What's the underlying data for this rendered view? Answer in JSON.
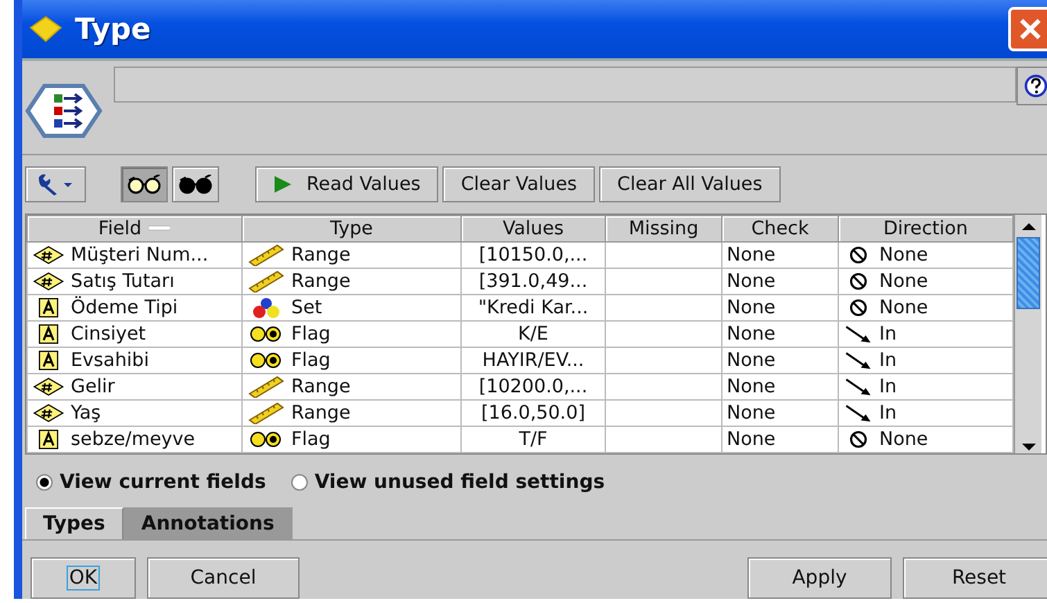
{
  "window": {
    "title": "Type"
  },
  "toolbar": {
    "views": [
      {
        "kind": "light",
        "selected": true
      },
      {
        "kind": "dark",
        "selected": false
      }
    ],
    "buttons": [
      {
        "label": "Read Values",
        "kind": "play"
      },
      {
        "label": "Clear Values",
        "kind": "plain"
      },
      {
        "label": "Clear All Values",
        "kind": "plain"
      }
    ]
  },
  "table": {
    "columns": [
      "Field",
      "Type",
      "Values",
      "Missing",
      "Check",
      "Direction"
    ],
    "rows": [
      {
        "field": {
          "label": "Müşteri Num...",
          "kind": "numeric"
        },
        "type": {
          "label": "Range",
          "kind": "range"
        },
        "values": "[10150.0,...",
        "check": "None",
        "direction": {
          "label": "None",
          "kind": "none"
        }
      },
      {
        "field": {
          "label": "Satış Tutarı",
          "kind": "numeric"
        },
        "type": {
          "label": "Range",
          "kind": "range"
        },
        "values": "[391.0,49...",
        "check": "None",
        "direction": {
          "label": "None",
          "kind": "none"
        }
      },
      {
        "field": {
          "label": "Ödeme Tipi",
          "kind": "string"
        },
        "type": {
          "label": "Set",
          "kind": "set"
        },
        "values": "\"Kredi Kar...",
        "check": "None",
        "direction": {
          "label": "None",
          "kind": "none"
        }
      },
      {
        "field": {
          "label": "Cinsiyet",
          "kind": "string"
        },
        "type": {
          "label": "Flag",
          "kind": "flag"
        },
        "values": "K/E",
        "check": "None",
        "direction": {
          "label": "In",
          "kind": "in"
        }
      },
      {
        "field": {
          "label": "Evsahibi",
          "kind": "string"
        },
        "type": {
          "label": "Flag",
          "kind": "flag"
        },
        "values": "HAYIR/EV...",
        "check": "None",
        "direction": {
          "label": "In",
          "kind": "in"
        }
      },
      {
        "field": {
          "label": "Gelir",
          "kind": "numeric"
        },
        "type": {
          "label": "Range",
          "kind": "range"
        },
        "values": "[10200.0,...",
        "check": "None",
        "direction": {
          "label": "In",
          "kind": "in"
        }
      },
      {
        "field": {
          "label": "Yaş",
          "kind": "numeric"
        },
        "type": {
          "label": "Range",
          "kind": "range"
        },
        "values": "[16.0,50.0]",
        "check": "None",
        "direction": {
          "label": "In",
          "kind": "in"
        }
      },
      {
        "field": {
          "label": "sebze/meyve",
          "kind": "string"
        },
        "type": {
          "label": "Flag",
          "kind": "flag"
        },
        "values": "T/F",
        "check": "None",
        "direction": {
          "label": "None",
          "kind": "none"
        }
      }
    ]
  },
  "view_options": [
    {
      "label": "View current fields",
      "selected": true
    },
    {
      "label": "View unused field settings",
      "selected": false
    }
  ],
  "tabs": [
    {
      "label": "Types",
      "selected": true
    },
    {
      "label": "Annotations",
      "selected": false
    }
  ],
  "buttons_left": [
    "OK",
    "Cancel"
  ],
  "buttons_right": [
    "Apply",
    "Reset"
  ]
}
